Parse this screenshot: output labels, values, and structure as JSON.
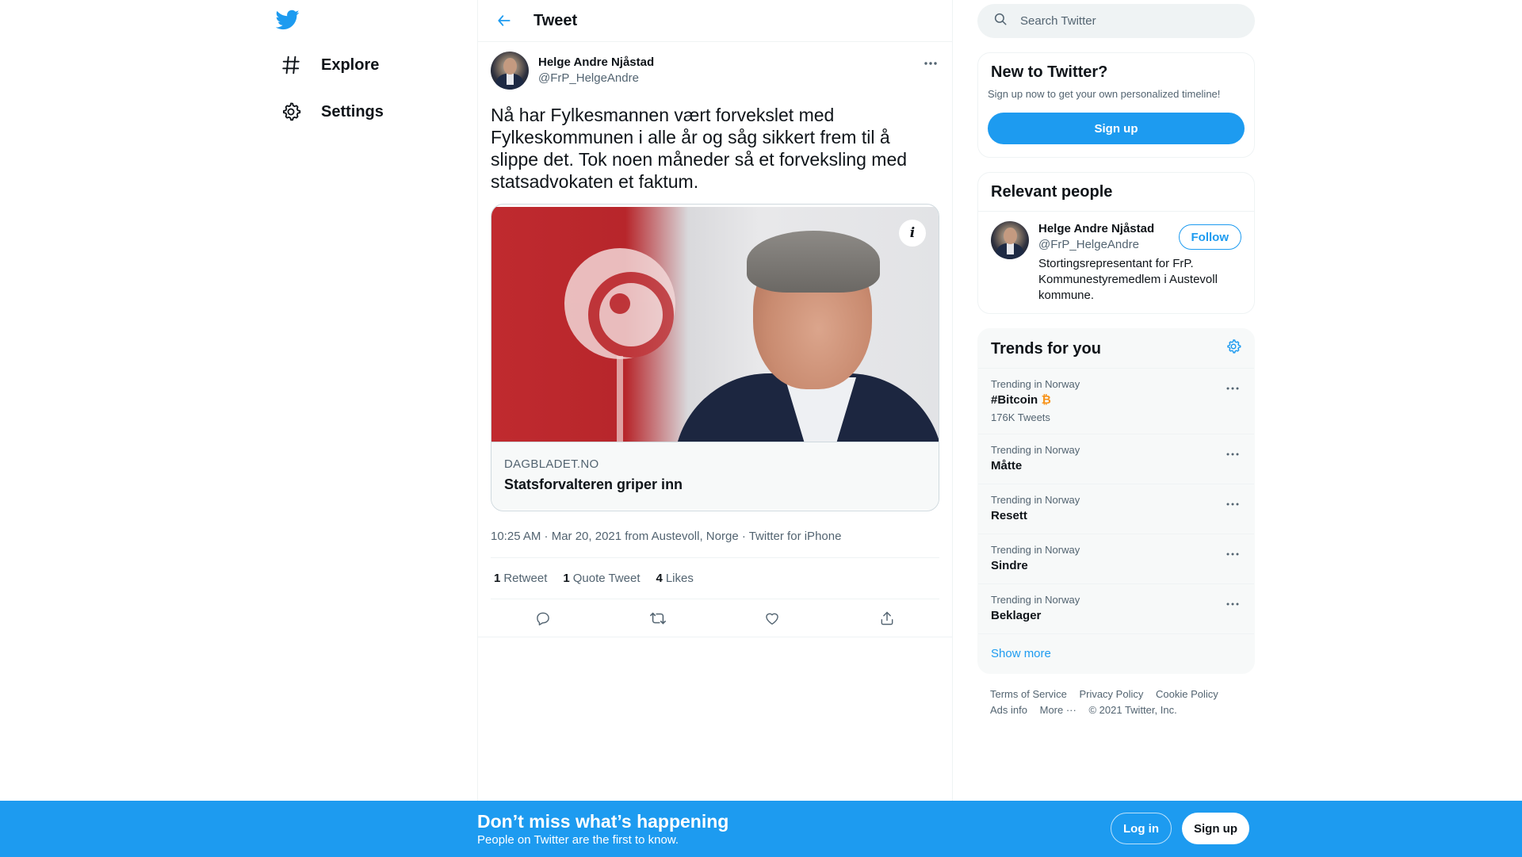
{
  "nav": {
    "logo_icon": "twitter-bird-icon",
    "items": [
      {
        "label": "Explore",
        "icon": "hashtag-icon"
      },
      {
        "label": "Settings",
        "icon": "gear-icon"
      }
    ]
  },
  "header": {
    "title": "Tweet"
  },
  "tweet": {
    "author_name": "Helge Andre Njåstad",
    "author_handle": "@FrP_HelgeAndre",
    "text": "Nå har Fylkesmannen vært forvekslet med Fylkeskommunen i alle år og såg sikkert frem til å slippe det. Tok noen måneder så et forveksling med statsadvokaten et faktum.",
    "card": {
      "domain": "DAGBLADET.NO",
      "title": "Statsforvalteren griper inn",
      "info_icon": "info-icon"
    },
    "meta": "10:25 AM · Mar 20, 2021 from Austevoll, Norge · Twitter for iPhone",
    "stats": [
      {
        "count": "1",
        "label": "Retweet"
      },
      {
        "count": "1",
        "label": "Quote Tweet"
      },
      {
        "count": "4",
        "label": "Likes"
      }
    ]
  },
  "search": {
    "placeholder": "Search Twitter"
  },
  "new_to_twitter": {
    "title": "New to Twitter?",
    "subtitle": "Sign up now to get your own personalized timeline!",
    "signup_label": "Sign up"
  },
  "relevant_people": {
    "title": "Relevant people",
    "name": "Helge Andre Njåstad",
    "handle": "@FrP_HelgeAndre",
    "bio": "Stortingsrepresentant for FrP. Kommunestyremedlem i Austevoll kommune.",
    "follow_label": "Follow"
  },
  "trends": {
    "title": "Trends for you",
    "items": [
      {
        "context": "Trending in Norway",
        "name": "#Bitcoin",
        "count": "176K Tweets"
      },
      {
        "context": "Trending in Norway",
        "name": "Måtte"
      },
      {
        "context": "Trending in Norway",
        "name": "Resett"
      },
      {
        "context": "Trending in Norway",
        "name": "Sindre"
      },
      {
        "context": "Trending in Norway",
        "name": "Beklager"
      }
    ],
    "show_more": "Show more"
  },
  "footer": {
    "links": [
      "Terms of Service",
      "Privacy Policy",
      "Cookie Policy",
      "Ads info",
      "More ···",
      "© 2021 Twitter, Inc."
    ]
  },
  "bottom_bar": {
    "title": "Don’t miss what’s happening",
    "subtitle": "People on Twitter are the first to know.",
    "login_label": "Log in",
    "signup_label": "Sign up"
  },
  "colors": {
    "accent": "#1d9bf0",
    "text": "#0f1419",
    "secondary": "#536471"
  }
}
